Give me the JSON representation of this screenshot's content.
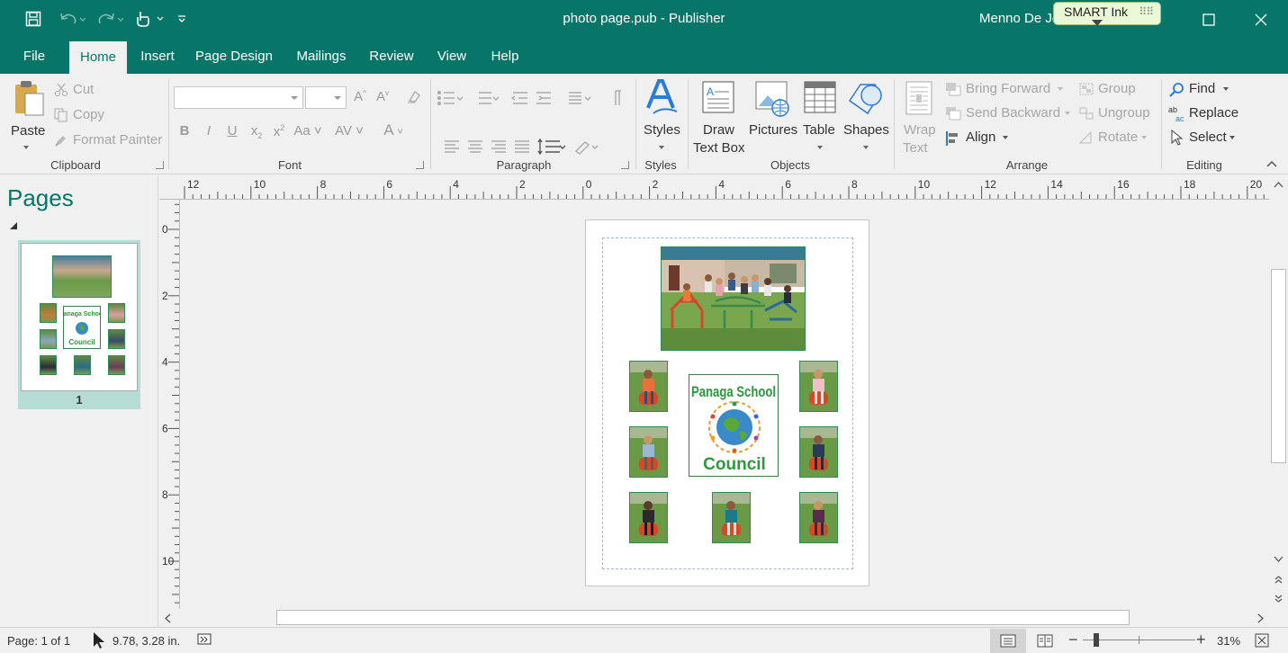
{
  "titlebar": {
    "title": "photo page.pub  -  Publisher",
    "user": "Menno De Jo",
    "smart_ink": "SMART Ink",
    "save_icon": "save-icon",
    "undo_icon": "undo-icon",
    "redo_icon": "redo-icon",
    "touch_icon": "touch-mode-icon"
  },
  "tabs": [
    {
      "label": "File"
    },
    {
      "label": "Home"
    },
    {
      "label": "Insert"
    },
    {
      "label": "Page Design"
    },
    {
      "label": "Mailings"
    },
    {
      "label": "Review"
    },
    {
      "label": "View"
    },
    {
      "label": "Help"
    }
  ],
  "active_tab": "Home",
  "ribbon": {
    "clipboard": {
      "paste": "Paste",
      "cut": "Cut",
      "copy": "Copy",
      "format_painter": "Format Painter",
      "label": "Clipboard"
    },
    "font": {
      "label": "Font",
      "font_name": "",
      "font_size": ""
    },
    "paragraph": {
      "label": "Paragraph"
    },
    "styles": {
      "button": "Styles",
      "label": "Styles"
    },
    "objects": {
      "draw_text_box_line1": "Draw",
      "draw_text_box_line2": "Text Box",
      "pictures": "Pictures",
      "table": "Table",
      "shapes": "Shapes",
      "label": "Objects"
    },
    "arrange": {
      "wrap_text_line1": "Wrap",
      "wrap_text_line2": "Text",
      "bring_forward": "Bring Forward",
      "send_backward": "Send Backward",
      "align": "Align",
      "group": "Group",
      "ungroup": "Ungroup",
      "rotate": "Rotate",
      "label": "Arrange"
    },
    "editing": {
      "find": "Find",
      "replace": "Replace",
      "select": "Select",
      "label": "Editing"
    }
  },
  "pages_panel": {
    "title": "Pages",
    "page_number": "1"
  },
  "ruler": {
    "h_labels": [
      "12",
      "10",
      "8",
      "6",
      "4",
      "2",
      "0",
      "2",
      "4",
      "6",
      "8",
      "10",
      "12",
      "14",
      "16",
      "18",
      "20"
    ],
    "v_labels": [
      "0",
      "2",
      "4",
      "6",
      "8",
      "10"
    ]
  },
  "document": {
    "logo_line1": "Panaga School",
    "logo_line2": "Council"
  },
  "status": {
    "page": "Page: 1 of 1",
    "position": "9.78, 3.28 in.",
    "zoom": "31%"
  },
  "colors": {
    "accent": "#077568",
    "logo_green": "#2a9a3a"
  }
}
